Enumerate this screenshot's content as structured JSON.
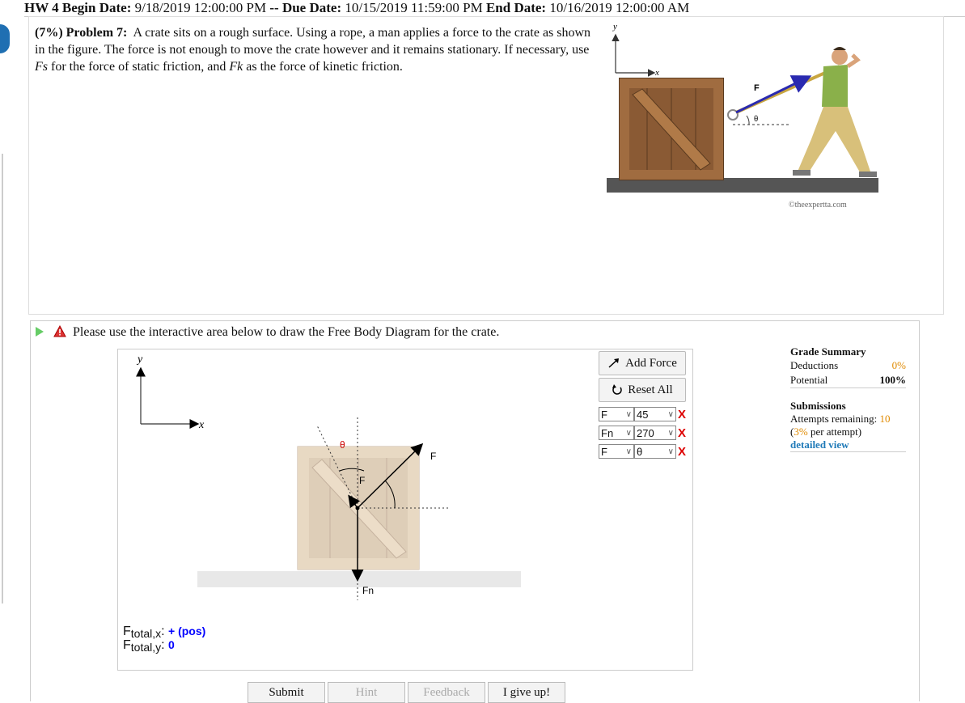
{
  "header": {
    "hw_label": "HW 4",
    "begin_label": "Begin Date:",
    "begin_value": "9/18/2019 12:00:00 PM",
    "sep": "--",
    "due_label": "Due Date:",
    "due_value": "10/15/2019 11:59:00 PM",
    "end_label": "End Date:",
    "end_value": "10/16/2019 12:00:00 AM"
  },
  "problem": {
    "weight": "(7%)",
    "number": "Problem 7:",
    "text_1": "A crate sits on a rough surface. Using a rope, a man applies a force to the crate as shown in the figure. The force is not enough to move the crate however and it remains stationary. If necessary, use ",
    "fs": "Fs",
    "text_2": " for the force of static friction, and ",
    "fk": "Fk",
    "text_3": " as the force of kinetic friction."
  },
  "figure": {
    "axis_y": "y",
    "axis_x": "x",
    "force_label": "F",
    "angle_label": "θ",
    "copyright": "©theexpertta.com"
  },
  "fbd": {
    "instruction": "Please use the interactive area below to draw the Free Body Diagram for the crate.",
    "axis_y": "y",
    "axis_x": "x",
    "label_theta": "θ",
    "label_f_top": "F",
    "label_f_inner": "F",
    "label_fn": "Fn",
    "ftotal_x_label": "total,x",
    "ftotal_x_value": "+ (pos)",
    "ftotal_y_label": "total,y",
    "ftotal_y_value": "0",
    "ftotal_prefix": "F"
  },
  "panel": {
    "add_force": "Add Force",
    "reset_all": "Reset All",
    "forces": [
      {
        "name": "F",
        "value": "45"
      },
      {
        "name": "Fn",
        "value": "270"
      },
      {
        "name": "F",
        "value": "θ"
      }
    ],
    "delete_symbol": "X"
  },
  "grade": {
    "title": "Grade Summary",
    "deductions_label": "Deductions",
    "deductions_value": "0%",
    "potential_label": "Potential",
    "potential_value": "100%",
    "submissions_title": "Submissions",
    "attempts_label": "Attempts remaining:",
    "attempts_value": "10",
    "per_attempt_pct": "3%",
    "per_attempt_text": "per attempt)",
    "detailed_view": "detailed view"
  },
  "buttons": {
    "submit": "Submit",
    "hint": "Hint",
    "feedback": "Feedback",
    "give_up": "I give up!"
  },
  "colors": {
    "accent_blue": "#1f6fb2",
    "delete_red": "#dd0000",
    "orange": "#e08a00",
    "link_blue": "#1f7ab8",
    "value_blue": "#0000ff"
  }
}
